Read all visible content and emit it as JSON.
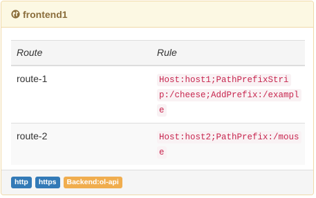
{
  "panel": {
    "title": "frontend1",
    "icon": "globe-icon"
  },
  "table": {
    "headers": {
      "route": "Route",
      "rule": "Rule"
    },
    "rows": [
      {
        "route": "route-1",
        "rule": "Host:host1;PathPrefixStrip:/cheese;AddPrefix:/example"
      },
      {
        "route": "route-2",
        "rule": "Host:host2;PathPrefix:/mouse"
      }
    ]
  },
  "footer": {
    "badges": [
      {
        "label": "http",
        "color": "#337ab7"
      },
      {
        "label": "https",
        "color": "#337ab7"
      },
      {
        "label": "Backend:ol-api",
        "color": "#f0ad4e"
      }
    ]
  },
  "colors": {
    "heading_bg": "#fcf8e3",
    "heading_text": "#8a6d3b",
    "code_text": "#c7254e",
    "code_bg": "#f9f2f4"
  }
}
